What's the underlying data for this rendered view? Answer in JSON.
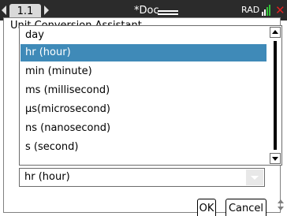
{
  "titlebar": {
    "tab_label": "1.1",
    "document_title": "*Doc",
    "angle_mode": "RAD"
  },
  "dialog": {
    "title": "Unit Conversion Assistant",
    "ok_label": "OK",
    "cancel_label": "Cancel"
  },
  "unit_list": {
    "items": [
      {
        "label": "day"
      },
      {
        "label": "hr (hour)"
      },
      {
        "label": "min (minute)"
      },
      {
        "label": "ms (millisecond)"
      },
      {
        "label": "μs(microsecond)"
      },
      {
        "label": "ns (nanosecond)"
      },
      {
        "label": "s (second)"
      }
    ],
    "selected": "hr (hour)"
  },
  "unit_select": {
    "value": "hr (hour)"
  },
  "colors": {
    "selection": "#3f8ab8",
    "titlebar": "#2b2b2b",
    "close": "#e02020"
  },
  "icons": {
    "prev_page": "chevron-left-icon",
    "next_page": "chevron-right-icon",
    "battery": "battery-icon",
    "signal": "signal-icon",
    "close": "close-icon"
  }
}
